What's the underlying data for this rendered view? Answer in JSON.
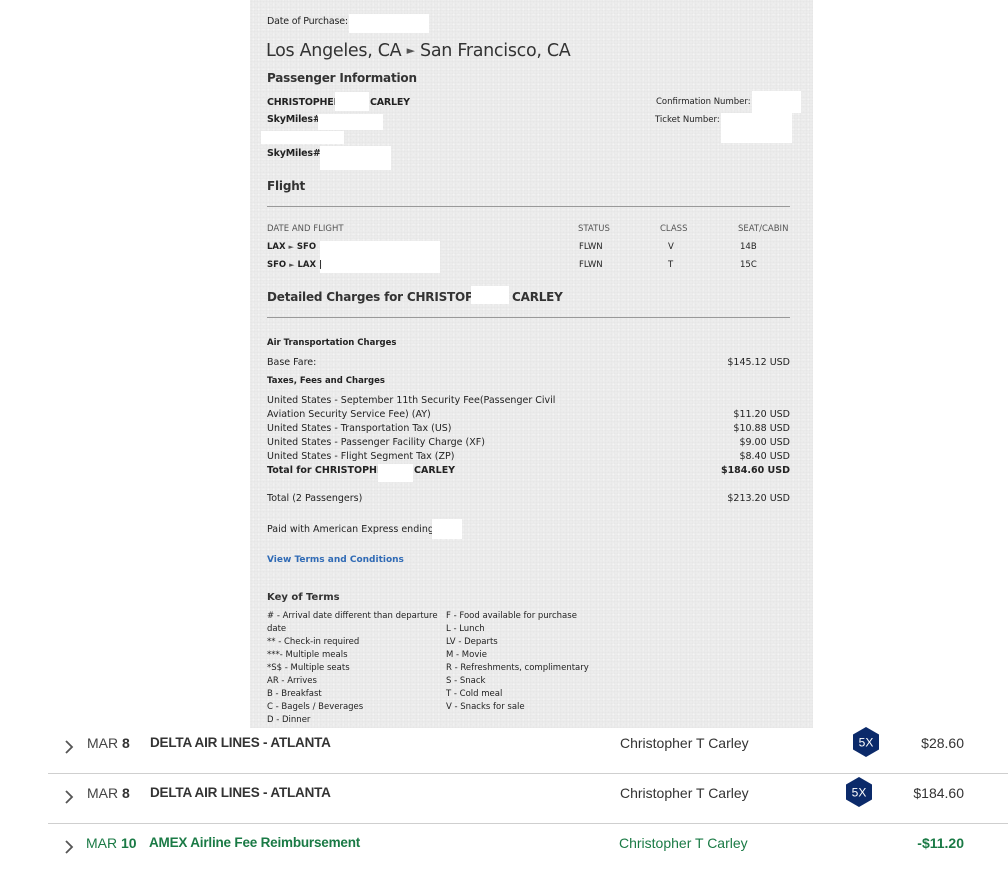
{
  "receipt": {
    "date_of_purchase_label": "Date of Purchase:",
    "route_from": "Los Angeles, CA",
    "route_to": "San Francisco, CA",
    "route_arrow": "►",
    "passenger_info_heading": "Passenger Information",
    "passenger1_first": "CHRISTOPHER",
    "passenger1_last": "CARLEY",
    "skymiles_label": "SkyMiles#:",
    "confirmation_label": "Confirmation Number:",
    "ticket_label": "Ticket Number:",
    "flight_heading": "Flight",
    "flight_table": {
      "headers": [
        "DATE AND FLIGHT",
        "STATUS",
        "CLASS",
        "SEAT/CABIN"
      ],
      "rows": [
        {
          "from": "LAX",
          "to": "SFO",
          "status": "FLWN",
          "class": "V",
          "seat": "14B"
        },
        {
          "from": "SFO",
          "to": "LAX",
          "status": "FLWN",
          "class": "T",
          "seat": "15C"
        }
      ],
      "separator": "|"
    },
    "charges_heading_prefix": "Detailed Charges for CHRISTOPHER",
    "charges_heading_suffix": "CARLEY",
    "air_transport_label": "Air Transportation Charges",
    "base_fare_label": "Base Fare:",
    "base_fare_amount": "$145.12",
    "currency": "USD",
    "taxes_label": "Taxes, Fees and Charges",
    "tax_lines": [
      {
        "label_line1": "United States - September 11th Security Fee(Passenger Civil",
        "label_line2": "Aviation Security Service Fee) (AY)",
        "amount": "$11.20"
      },
      {
        "label": "United States - Transportation Tax (US)",
        "amount": "$10.88"
      },
      {
        "label": "United States - Passenger Facility Charge (XF)",
        "amount": "$9.00"
      },
      {
        "label": "United States - Flight Segment Tax (ZP)",
        "amount": "$8.40"
      }
    ],
    "total_for_prefix": "Total for CHRISTOPHER",
    "total_for_suffix": "CARLEY",
    "total_for_amount": "$184.60",
    "total_passengers_label": "Total (2 Passengers)",
    "total_passengers_amount": "$213.20",
    "paid_with_label": "Paid with American Express ending",
    "terms_link": "View Terms and Conditions",
    "key_heading": "Key of Terms",
    "key_left": [
      "# - Arrival date different than departure",
      "date",
      "** - Check-in required",
      "***- Multiple meals",
      "*S$ - Multiple seats",
      "AR - Arrives",
      "B - Breakfast",
      "C - Bagels / Beverages",
      "D - Dinner"
    ],
    "key_right": [
      "F - Food available for purchase",
      "L - Lunch",
      "LV - Departs",
      "M - Movie",
      "R - Refreshments, complimentary",
      "S - Snack",
      "T - Cold meal",
      "V - Snacks for sale"
    ]
  },
  "transactions": [
    {
      "month": "MAR",
      "day": "8",
      "description": "DELTA AIR LINES - ATLANTA",
      "cardmember": "Christopher T Carley",
      "badge": "5X",
      "amount": "$28.60",
      "icon": "chevron-right-icon"
    },
    {
      "month": "MAR",
      "day": "8",
      "description": "DELTA AIR LINES - ATLANTA",
      "cardmember": "Christopher T Carley",
      "badge": "5X",
      "amount": "$184.60",
      "icon": "chevron-right-icon"
    },
    {
      "month": "MAR",
      "day": "10",
      "description": "AMEX Airline Fee Reimbursement",
      "cardmember": "Christopher T Carley",
      "badge": null,
      "amount": "-$11.20",
      "icon": "chevron-right-icon"
    }
  ],
  "colors": {
    "badge_navy": "#0b2a6a",
    "credit_green": "#1a7a45",
    "link_blue": "#2f6ab5",
    "receipt_bg": "#ececec"
  }
}
